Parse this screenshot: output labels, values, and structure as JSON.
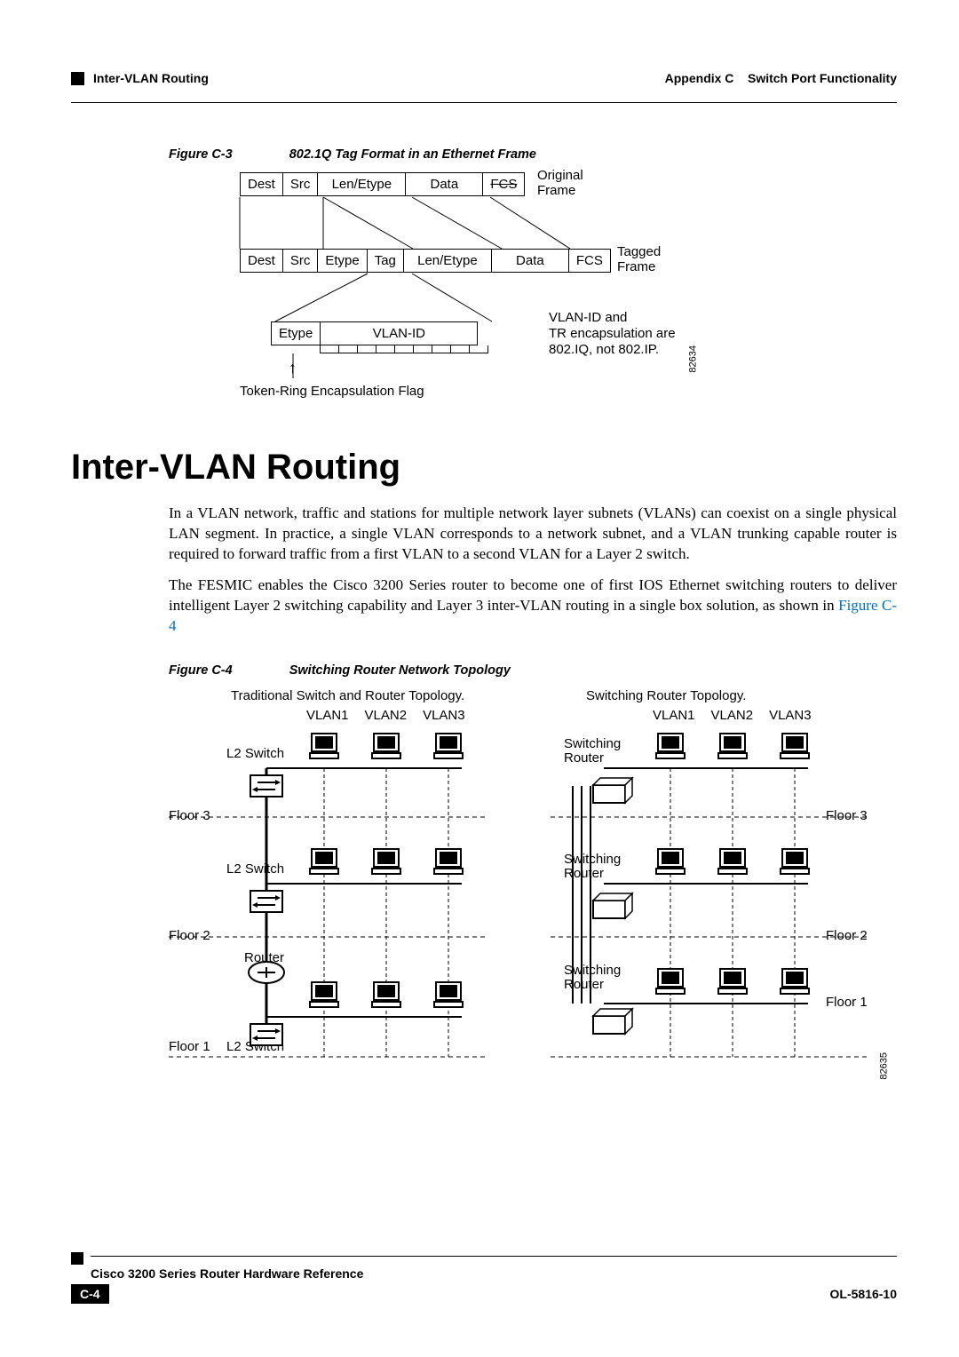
{
  "header": {
    "appendix": "Appendix C",
    "appendix_title": "Switch Port Functionality",
    "section": "Inter-VLAN Routing"
  },
  "figC3": {
    "label": "Figure C-3",
    "title": "802.1Q Tag Format in an Ethernet Frame",
    "original_row": [
      "Dest",
      "Src",
      "Len/Etype",
      "Data",
      "FCS"
    ],
    "original_side": "Original\nFrame",
    "tagged_row": [
      "Dest",
      "Src",
      "Etype",
      "Tag",
      "Len/Etype",
      "Data",
      "FCS"
    ],
    "tagged_side": "Tagged\nFrame",
    "tag_detail": [
      "Etype",
      "VLAN-ID"
    ],
    "vlan_note": "VLAN-ID and\nTR encapsulation are\n802.IQ, not 802.IP.",
    "tr_flag": "Token-Ring Encapsulation Flag",
    "id": "82634"
  },
  "section_title": "Inter-VLAN Routing",
  "para1": "In a VLAN network, traffic and stations for multiple network layer subnets (VLANs) can coexist on a single physical LAN segment. In practice, a single VLAN corresponds to a network subnet, and a VLAN trunking capable router is required to forward traffic from a first VLAN to a second VLAN for a Layer 2 switch.",
  "para2_a": "The FESMIC enables the Cisco 3200 Series router to become one of first IOS Ethernet switching routers to deliver intelligent Layer 2 switching capability and Layer 3 inter-VLAN routing in a single box solution, as shown in ",
  "para2_link": "Figure C-4",
  "figC4": {
    "label": "Figure C-4",
    "title": "Switching Router Network Topology",
    "left_title": "Traditional Switch and Router Topology.",
    "right_title": "Switching Router Topology.",
    "vlan_labels": [
      "VLAN1",
      "VLAN2",
      "VLAN3"
    ],
    "l2switch": "L2 Switch",
    "router": "Router",
    "sw_router": "Switching\nRouter",
    "floor1": "Floor 1",
    "floor2": "Floor 2",
    "floor3": "Floor 3",
    "id": "82635"
  },
  "footer": {
    "doc_title": "Cisco 3200 Series Router Hardware Reference",
    "page": "C-4",
    "doc_id": "OL-5816-10"
  }
}
